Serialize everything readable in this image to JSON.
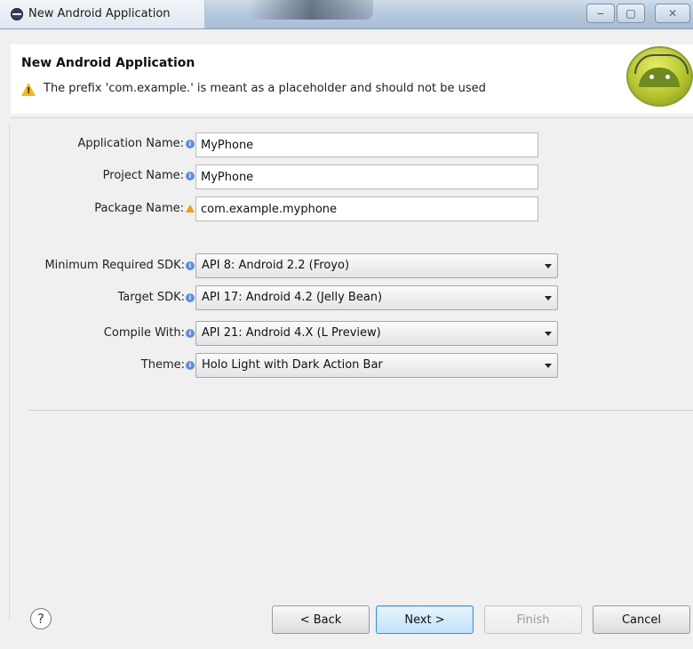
{
  "window": {
    "title": "New Android Application"
  },
  "header": {
    "title": "New Android Application",
    "message": "The prefix 'com.example.' is meant as a placeholder and should not be used"
  },
  "fields": {
    "application_name": {
      "label": "Application Name:",
      "value": "MyPhone"
    },
    "project_name": {
      "label": "Project Name:",
      "value": "MyPhone"
    },
    "package_name": {
      "label": "Package Name:",
      "value": "com.example.myphone"
    }
  },
  "sdk": {
    "min_sdk": {
      "label": "Minimum Required SDK:",
      "value": "API 8: Android 2.2 (Froyo)"
    },
    "target_sdk": {
      "label": "Target SDK:",
      "value": "API 17: Android 4.2 (Jelly Bean)"
    },
    "compile_with": {
      "label": "Compile With:",
      "value": "API 21: Android 4.X (L Preview)"
    },
    "theme": {
      "label": "Theme:",
      "value": "Holo Light with Dark Action Bar"
    }
  },
  "buttons": {
    "help": "?",
    "back": "< Back",
    "next": "Next >",
    "finish": "Finish",
    "cancel": "Cancel"
  },
  "icons": {
    "window_controls": [
      "minimize-icon",
      "maximize-icon",
      "close-icon"
    ],
    "info": "info-icon",
    "warning": "warning-icon"
  },
  "colors": {
    "warning": "#f2b81c",
    "info": "#5f8fd6",
    "primary_button_border": "#3f8fd8"
  }
}
